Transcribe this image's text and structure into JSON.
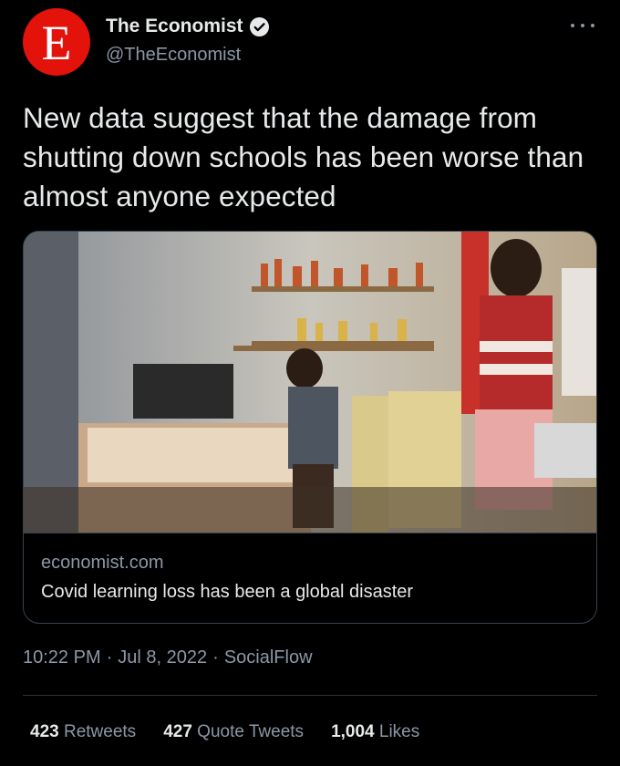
{
  "author": {
    "avatar_letter": "E",
    "display_name": "The Economist",
    "handle": "@TheEconomist",
    "avatar_color": "#e3120b",
    "verified": true
  },
  "icons": {
    "verified": "verified-badge-icon",
    "more": "more-options-icon"
  },
  "tweet": {
    "text": "New data suggest that the damage from shutting down schools has been worse than almost anyone expected"
  },
  "card": {
    "domain": "economist.com",
    "title": "Covid learning loss has been a global disaster"
  },
  "meta": {
    "time": "10:22 PM",
    "sep1": "·",
    "date": "Jul 8, 2022",
    "sep2": "·",
    "source": "SocialFlow"
  },
  "stats": {
    "retweets_count": "423",
    "retweets_label": "Retweets",
    "quotes_count": "427",
    "quotes_label": "Quote Tweets",
    "likes_count": "1,004",
    "likes_label": "Likes"
  },
  "colors": {
    "background": "#000000",
    "text_primary": "#e7e9ea",
    "text_secondary": "#8b98a5",
    "border": "#38444d"
  }
}
